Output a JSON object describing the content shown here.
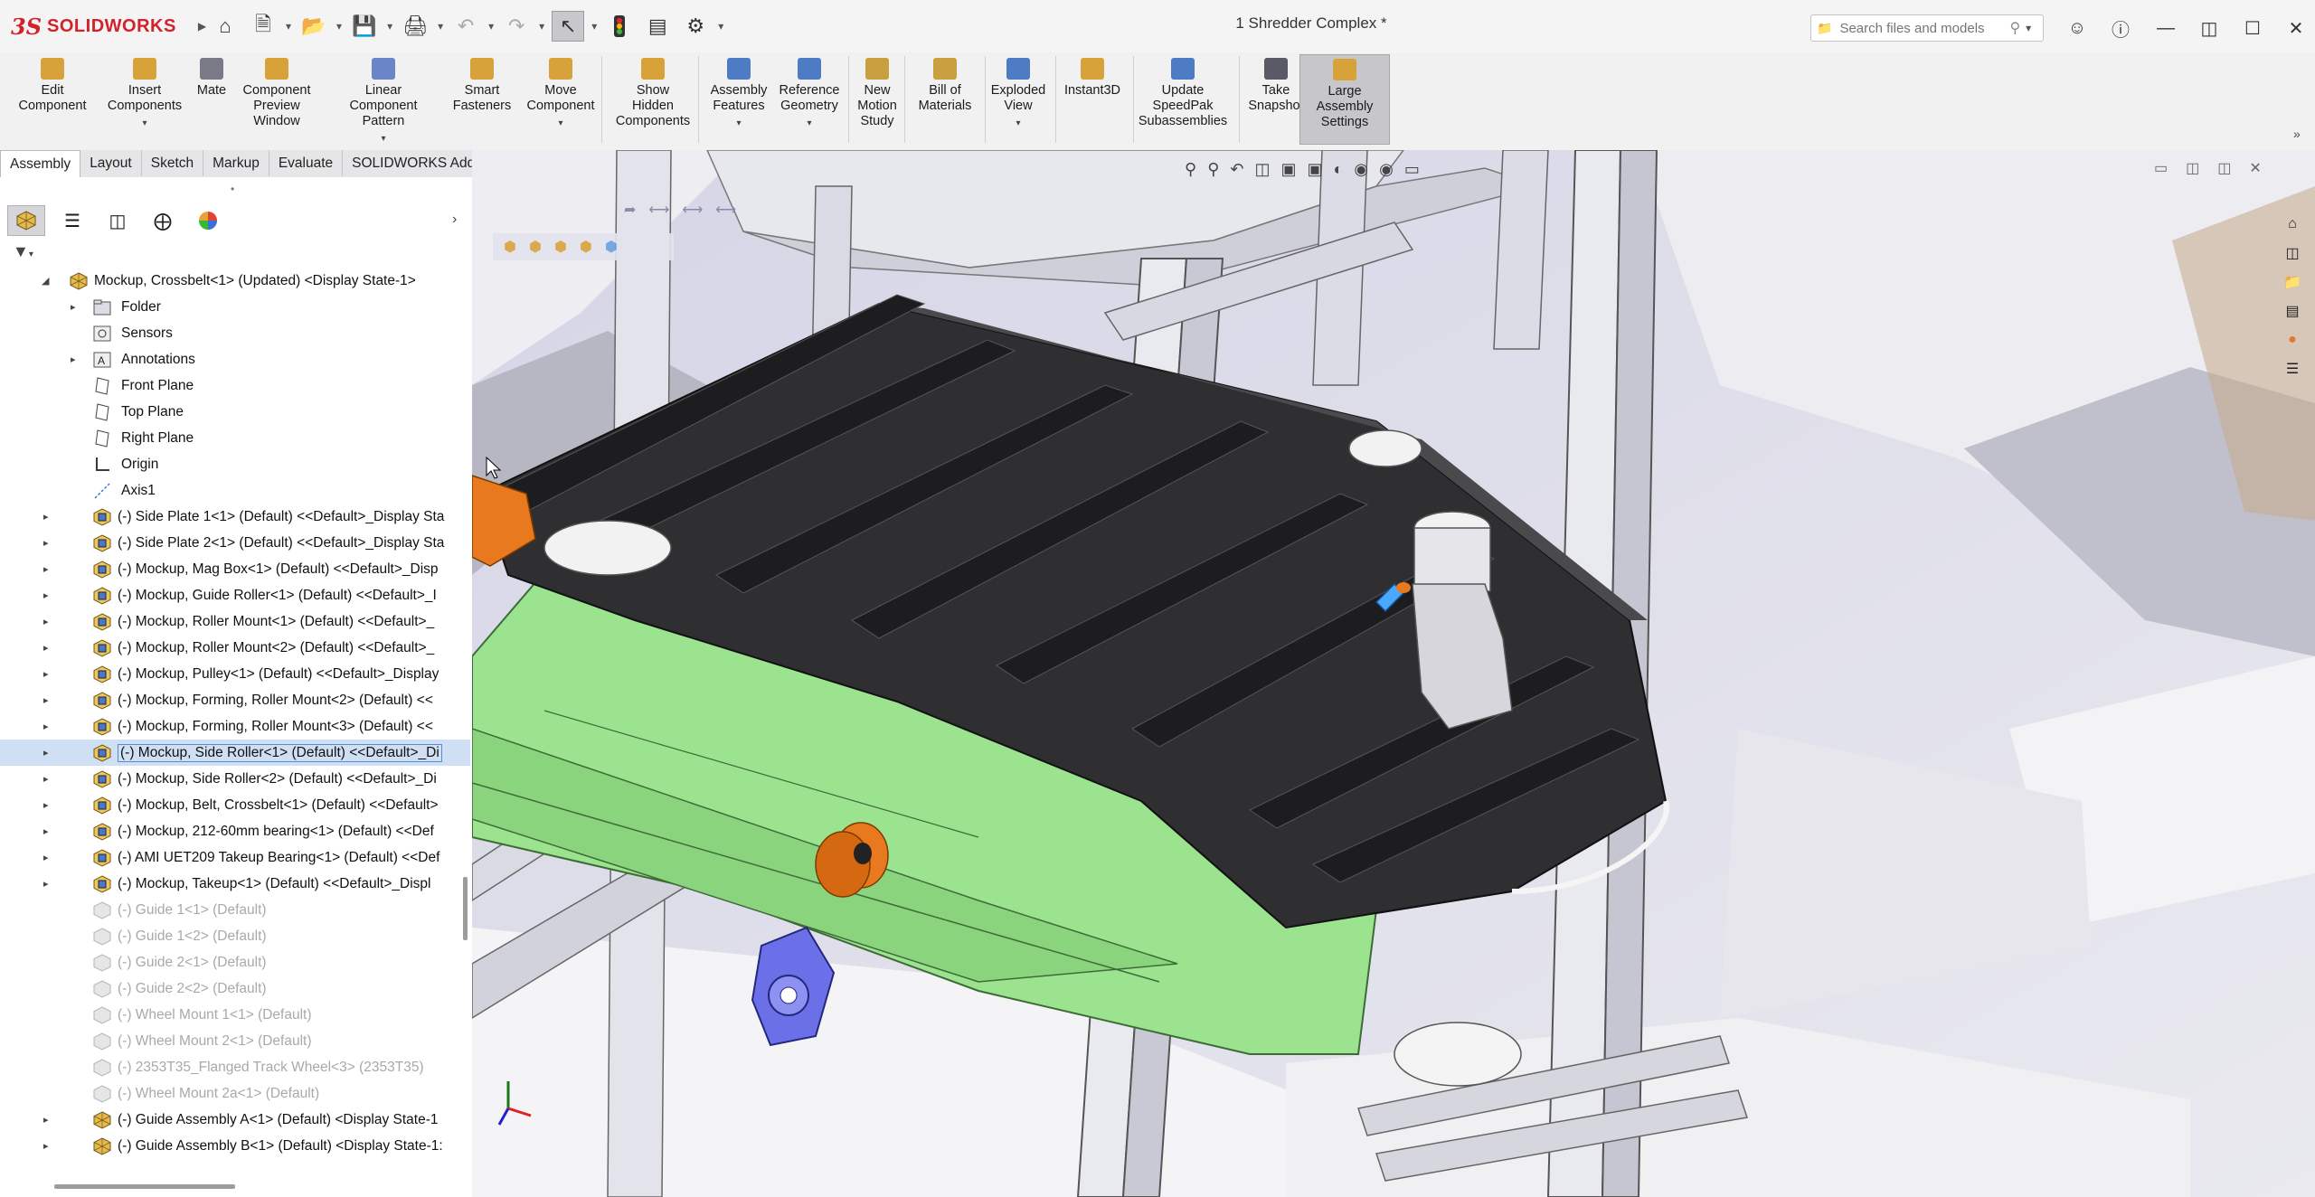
{
  "titlebar": {
    "logo_ds": "3S",
    "logo_text": "SOLIDWORKS",
    "document_title": "1 Shredder Complex *",
    "search_placeholder": "Search files and models"
  },
  "ribbon": [
    {
      "id": "edit-component",
      "lines": [
        "Edit",
        "Component"
      ],
      "dropdown": false
    },
    {
      "id": "insert-components",
      "lines": [
        "Insert",
        "Components"
      ],
      "dropdown": true
    },
    {
      "id": "mate",
      "lines": [
        "Mate"
      ],
      "dropdown": false
    },
    {
      "id": "component-preview-window",
      "lines": [
        "Component",
        "Preview",
        "Window"
      ],
      "dropdown": false
    },
    {
      "id": "linear-component-pattern",
      "lines": [
        "Linear Component",
        "Pattern"
      ],
      "dropdown": true
    },
    {
      "id": "smart-fasteners",
      "lines": [
        "Smart",
        "Fasteners"
      ],
      "dropdown": false
    },
    {
      "id": "move-component",
      "lines": [
        "Move",
        "Component"
      ],
      "dropdown": true
    },
    {
      "id": "show-hidden-components",
      "lines": [
        "Show",
        "Hidden",
        "Components"
      ],
      "dropdown": false
    },
    {
      "id": "assembly-features",
      "lines": [
        "Assembly",
        "Features"
      ],
      "dropdown": true
    },
    {
      "id": "reference-geometry",
      "lines": [
        "Reference",
        "Geometry"
      ],
      "dropdown": true
    },
    {
      "id": "new-motion-study",
      "lines": [
        "New",
        "Motion",
        "Study"
      ],
      "dropdown": false
    },
    {
      "id": "bill-of-materials",
      "lines": [
        "Bill of",
        "Materials"
      ],
      "dropdown": false
    },
    {
      "id": "exploded-view",
      "lines": [
        "Exploded",
        "View"
      ],
      "dropdown": true
    },
    {
      "id": "instant3d",
      "lines": [
        "Instant3D"
      ],
      "dropdown": false
    },
    {
      "id": "update-speedpak",
      "lines": [
        "Update",
        "SpeedPak",
        "Subassemblies"
      ],
      "dropdown": false
    },
    {
      "id": "take-snapshot",
      "lines": [
        "Take",
        "Snapshot"
      ],
      "dropdown": false
    },
    {
      "id": "large-assembly-settings",
      "lines": [
        "Large",
        "Assembly",
        "Settings"
      ],
      "dropdown": false
    }
  ],
  "tabs": [
    "Assembly",
    "Layout",
    "Sketch",
    "Markup",
    "Evaluate",
    "SOLIDWORKS Add-Ins"
  ],
  "tree": [
    {
      "level": 0,
      "expand": "open",
      "icon": "assembly",
      "text": "Mockup, Crossbelt<1> (Updated) <Display State-1>"
    },
    {
      "level": 1,
      "expand": "closed",
      "icon": "folder",
      "text": "Folder"
    },
    {
      "level": 1,
      "expand": "none",
      "icon": "sensor",
      "text": "Sensors"
    },
    {
      "level": 1,
      "expand": "closed",
      "icon": "annotation",
      "text": "Annotations"
    },
    {
      "level": 1,
      "expand": "none",
      "icon": "plane",
      "text": "Front Plane"
    },
    {
      "level": 1,
      "expand": "none",
      "icon": "plane",
      "text": "Top Plane"
    },
    {
      "level": 1,
      "expand": "none",
      "icon": "plane",
      "text": "Right Plane"
    },
    {
      "level": 1,
      "expand": "none",
      "icon": "origin",
      "text": "Origin"
    },
    {
      "level": 1,
      "expand": "none",
      "icon": "axis",
      "text": "Axis1"
    },
    {
      "level": 0,
      "expand": "closed",
      "icon": "part",
      "text": "(-) Side Plate 1<1> (Default) <<Default>_Display Sta"
    },
    {
      "level": 0,
      "expand": "closed",
      "icon": "part",
      "text": "(-) Side Plate 2<1> (Default) <<Default>_Display Sta"
    },
    {
      "level": 0,
      "expand": "closed",
      "icon": "part",
      "text": "(-) Mockup, Mag Box<1> (Default) <<Default>_Disp"
    },
    {
      "level": 0,
      "expand": "closed",
      "icon": "part",
      "text": "(-) Mockup, Guide Roller<1> (Default) <<Default>_I"
    },
    {
      "level": 0,
      "expand": "closed",
      "icon": "part",
      "text": "(-) Mockup, Roller Mount<1> (Default) <<Default>_"
    },
    {
      "level": 0,
      "expand": "closed",
      "icon": "part",
      "text": "(-) Mockup, Roller Mount<2> (Default) <<Default>_"
    },
    {
      "level": 0,
      "expand": "closed",
      "icon": "part",
      "text": "(-) Mockup, Pulley<1> (Default) <<Default>_Display"
    },
    {
      "level": 0,
      "expand": "closed",
      "icon": "part",
      "text": "(-) Mockup, Forming, Roller Mount<2> (Default) <<"
    },
    {
      "level": 0,
      "expand": "closed",
      "icon": "part",
      "text": "(-) Mockup, Forming, Roller Mount<3> (Default) <<"
    },
    {
      "level": 0,
      "expand": "closed",
      "icon": "part",
      "text": "(-) Mockup, Side Roller<1> (Default) <<Default>_Di",
      "selected": true
    },
    {
      "level": 0,
      "expand": "closed",
      "icon": "part",
      "text": "(-) Mockup, Side Roller<2> (Default) <<Default>_Di"
    },
    {
      "level": 0,
      "expand": "closed",
      "icon": "part",
      "text": "(-) Mockup, Belt, Crossbelt<1> (Default) <<Default>"
    },
    {
      "level": 0,
      "expand": "closed",
      "icon": "part",
      "text": "(-) Mockup, 212-60mm bearing<1> (Default) <<Def"
    },
    {
      "level": 0,
      "expand": "closed",
      "icon": "part",
      "text": "(-) AMI UET209 Takeup Bearing<1> (Default) <<Def"
    },
    {
      "level": 0,
      "expand": "closed",
      "icon": "part",
      "text": "(-) Mockup, Takeup<1> (Default) <<Default>_Displ"
    },
    {
      "level": 0,
      "expand": "none",
      "icon": "part-sup",
      "text": "(-) Guide 1<1> (Default)",
      "suppressed": true
    },
    {
      "level": 0,
      "expand": "none",
      "icon": "part-sup",
      "text": "(-) Guide 1<2> (Default)",
      "suppressed": true
    },
    {
      "level": 0,
      "expand": "none",
      "icon": "part-sup",
      "text": "(-) Guide 2<1> (Default)",
      "suppressed": true
    },
    {
      "level": 0,
      "expand": "none",
      "icon": "part-sup",
      "text": "(-) Guide 2<2> (Default)",
      "suppressed": true
    },
    {
      "level": 0,
      "expand": "none",
      "icon": "part-sup",
      "text": "(-) Wheel Mount 1<1> (Default)",
      "suppressed": true
    },
    {
      "level": 0,
      "expand": "none",
      "icon": "part-sup",
      "text": "(-) Wheel Mount 2<1> (Default)",
      "suppressed": true
    },
    {
      "level": 0,
      "expand": "none",
      "icon": "part-sup",
      "text": "(-) 2353T35_Flanged Track Wheel<3> (2353T35)",
      "suppressed": true
    },
    {
      "level": 0,
      "expand": "none",
      "icon": "part-sup",
      "text": "(-) Wheel Mount 2a<1> (Default)",
      "suppressed": true
    },
    {
      "level": 0,
      "expand": "closed",
      "icon": "assembly",
      "text": "(-) Guide Assembly A<1> (Default) <Display State-1"
    },
    {
      "level": 0,
      "expand": "closed",
      "icon": "assembly",
      "text": "(-) Guide Assembly B<1> (Default) <Display State-1:"
    }
  ],
  "colors": {
    "accent_red": "#d2232a",
    "selection": "#cfe0f5",
    "belt": "#2f2f31",
    "frame_green": "#9be38f",
    "roller_orange": "#e8791e",
    "bearing_blue": "#6c70e8"
  }
}
